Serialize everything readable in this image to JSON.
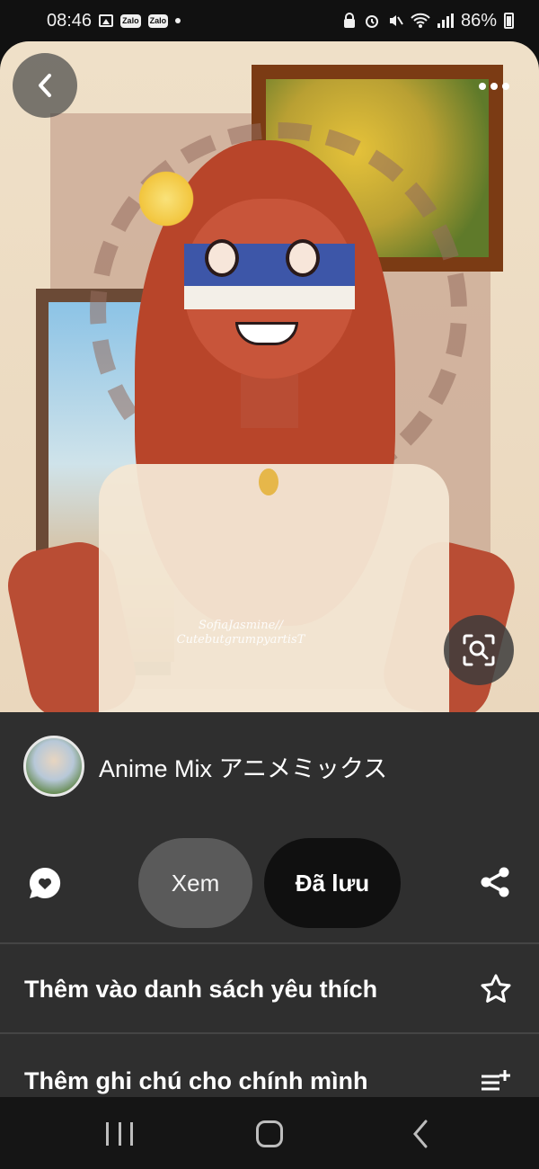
{
  "status_bar": {
    "time": "08:46",
    "app_badge_1": "Zalo",
    "app_badge_2": "Zalo",
    "battery": "86%"
  },
  "pin": {
    "watermark_line1": "SofiaJasmine//",
    "watermark_line2": "CutebutgrumpyartisT"
  },
  "creator": {
    "name": "Anime Mix アニメミックス"
  },
  "actions": {
    "view_label": "Xem",
    "saved_label": "Đã lưu"
  },
  "menu": {
    "favorite_label": "Thêm vào danh sách yêu thích",
    "note_label": "Thêm ghi chú cho chính mình"
  },
  "icons": {
    "back": "chevron-left-icon",
    "more": "more-dots-icon",
    "lens": "visual-search-icon",
    "comment": "comment-heart-icon",
    "share": "share-icon",
    "star": "star-icon",
    "add_note": "add-list-icon"
  },
  "colors": {
    "panel": "#2f2f2f",
    "view_button": "#5a5a5a",
    "saved_button": "#101010"
  }
}
